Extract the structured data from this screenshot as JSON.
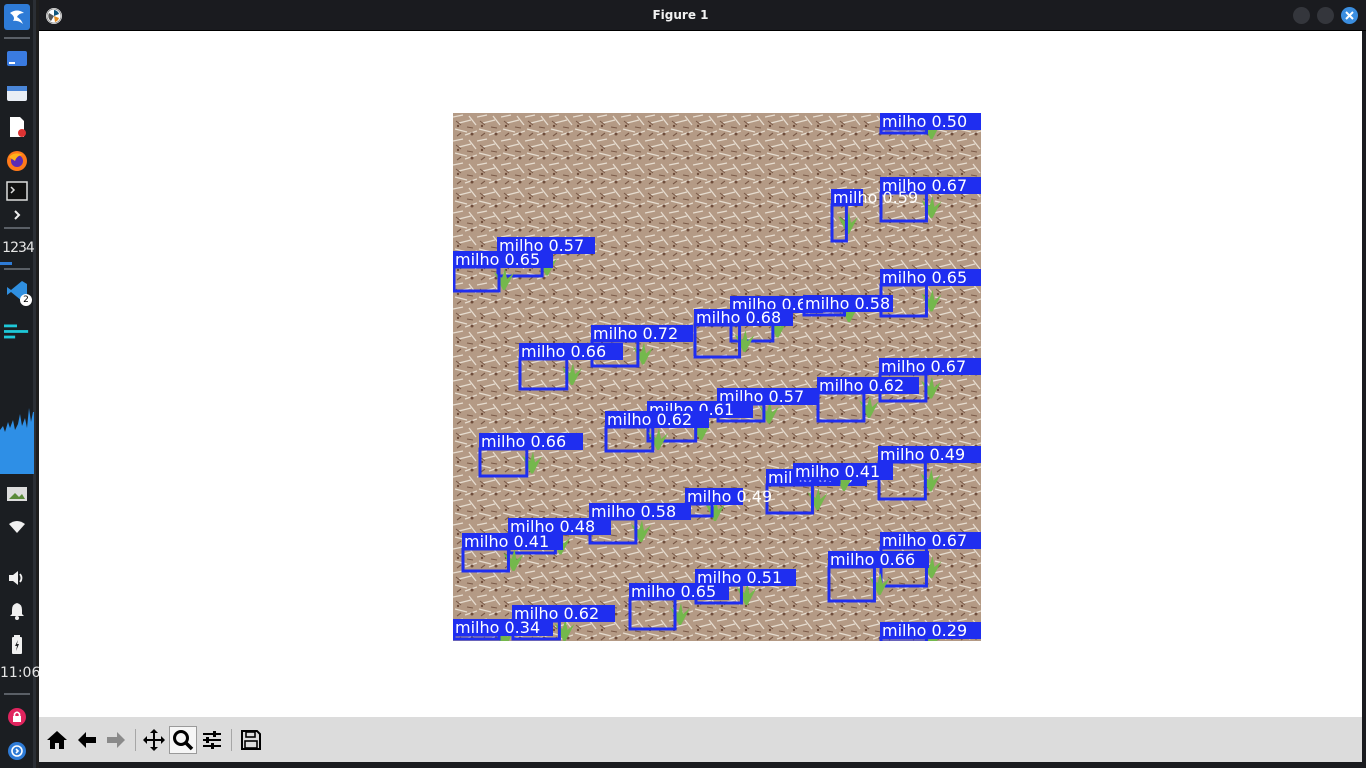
{
  "window": {
    "title": "Figure 1"
  },
  "panel": {
    "workspaces": "1234",
    "clock": "11:06",
    "vscode_badge": "2"
  },
  "toolbar": {
    "tools": [
      "home",
      "back",
      "forward",
      "pan",
      "zoom",
      "configure-subplots",
      "save"
    ],
    "active_tool": "zoom"
  },
  "image": {
    "description_class_label": "milho",
    "detections": [
      {
        "label": "milho 0.50"
      },
      {
        "label": "milho 0.67"
      },
      {
        "label": "milho 0.59"
      },
      {
        "label": "milho 0.57"
      },
      {
        "label": "milho 0.65"
      },
      {
        "label": "milho 0.65"
      },
      {
        "label": "milho 0.60"
      },
      {
        "label": "milho 0.58"
      },
      {
        "label": "milho 0.68"
      },
      {
        "label": "milho 0.72"
      },
      {
        "label": "milho 0.66"
      },
      {
        "label": "milho 0.67"
      },
      {
        "label": "milho 0.62"
      },
      {
        "label": "milho 0.57"
      },
      {
        "label": "milho 0.61"
      },
      {
        "label": "milho 0.62"
      },
      {
        "label": "milho 0.66"
      },
      {
        "label": "milho 0.49"
      },
      {
        "label": "milho 0.43"
      },
      {
        "label": "milho 0.41"
      },
      {
        "label": "milho 0.58"
      },
      {
        "label": "milho 0.49"
      },
      {
        "label": "milho 0.48"
      },
      {
        "label": "milho 0.41"
      },
      {
        "label": "milho 0.67"
      },
      {
        "label": "milho 0.66"
      },
      {
        "label": "milho 0.51"
      },
      {
        "label": "milho 0.65"
      },
      {
        "label": "milho 0.62"
      },
      {
        "label": "milho 0.34"
      },
      {
        "label": "milho 0.29"
      }
    ]
  }
}
